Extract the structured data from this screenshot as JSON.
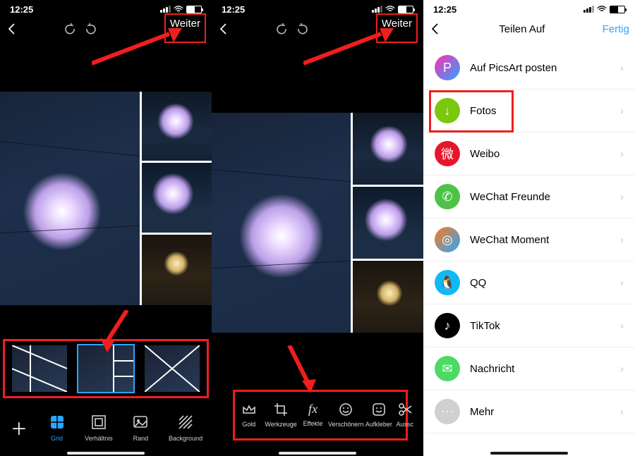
{
  "status": {
    "time": "12:25"
  },
  "panel1": {
    "nav": {
      "next_label": "Weiter"
    },
    "tabs": {
      "add_icon": "plus-icon",
      "items": [
        {
          "label": "Grid",
          "active": true
        },
        {
          "label": "Verhältnis",
          "active": false
        },
        {
          "label": "Rand",
          "active": false
        },
        {
          "label": "Background",
          "active": false
        }
      ]
    }
  },
  "panel2": {
    "nav": {
      "next_label": "Weiter"
    },
    "tools": [
      {
        "label": "Gold"
      },
      {
        "label": "Werkzeuge"
      },
      {
        "label": "Effekte"
      },
      {
        "label": "Verschönern"
      },
      {
        "label": "Aufkleber"
      },
      {
        "label": "Aussc"
      }
    ]
  },
  "panel3": {
    "nav": {
      "title": "Teilen Auf",
      "done_label": "Fertig"
    },
    "share_items": [
      {
        "label": "Auf PicsArt posten",
        "color_a": "#ff2fb0",
        "color_b": "#2aa6ff",
        "glyph": "P"
      },
      {
        "label": "Fotos",
        "color": "#7ac70c",
        "glyph": "↓"
      },
      {
        "label": "Weibo",
        "color": "#e6162d",
        "glyph": "微"
      },
      {
        "label": "WeChat Freunde",
        "color": "#4dc247",
        "glyph": "✆"
      },
      {
        "label": "WeChat Moment",
        "color_a": "#ff7a18",
        "color_b": "#2aa6ff",
        "glyph": "◎"
      },
      {
        "label": "QQ",
        "color": "#12b7f5",
        "glyph": "🐧"
      },
      {
        "label": "TikTok",
        "color": "#000000",
        "glyph": "♪"
      },
      {
        "label": "Nachricht",
        "color": "#4cd964",
        "glyph": "✉"
      },
      {
        "label": "Mehr",
        "color": "#d0d0d0",
        "glyph": "⋯"
      }
    ]
  }
}
